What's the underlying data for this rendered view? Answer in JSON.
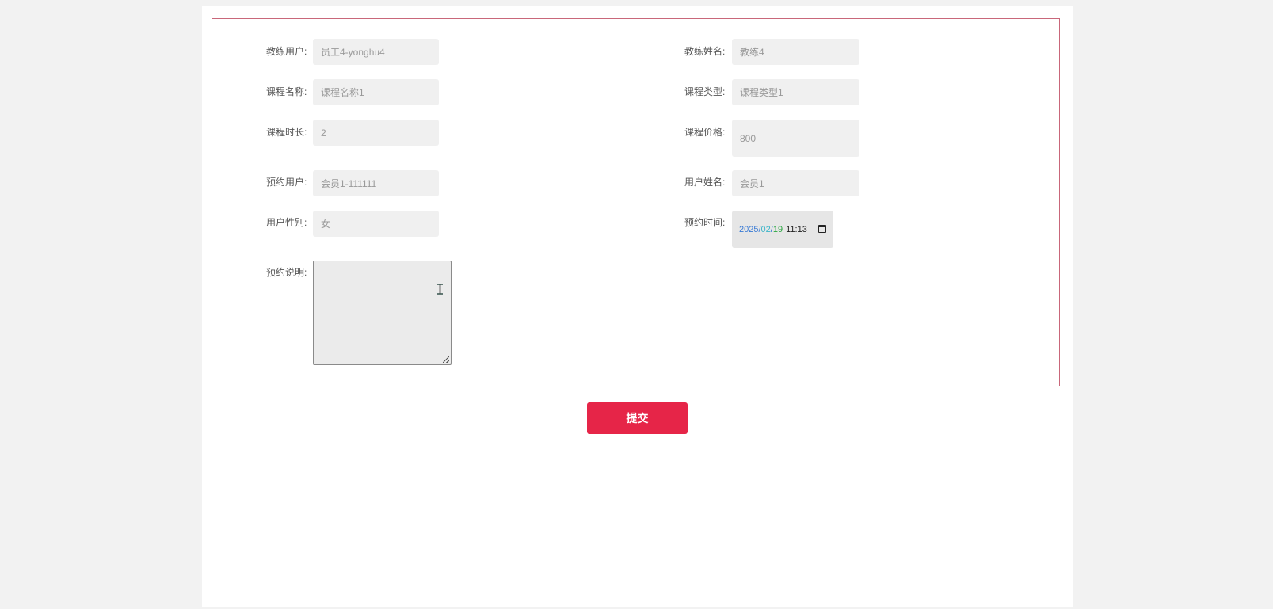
{
  "form": {
    "fields": [
      {
        "label": "教练用户:",
        "value": "员工4-yonghu4"
      },
      {
        "label": "教练姓名:",
        "value": "教练4"
      },
      {
        "label": "课程名称:",
        "value": "课程名称1"
      },
      {
        "label": "课程类型:",
        "value": "课程类型1"
      },
      {
        "label": "课程时长:",
        "value": "2"
      },
      {
        "label": "课程价格:",
        "value": "800"
      },
      {
        "label": "预约用户:",
        "value": "会员1-111111"
      },
      {
        "label": "用户姓名:",
        "value": "会员1"
      },
      {
        "label": "用户性别:",
        "value": "女"
      },
      {
        "label": "预约时间:",
        "value": ""
      }
    ],
    "appointment_time": {
      "year": "2025",
      "month": "02",
      "day": "19",
      "time": "11:13",
      "sep": "/"
    },
    "notes": {
      "label": "预约说明:",
      "value": ""
    },
    "submit_label": "提交"
  },
  "colors": {
    "accent": "#e62548",
    "form_border": "#c9677a"
  }
}
